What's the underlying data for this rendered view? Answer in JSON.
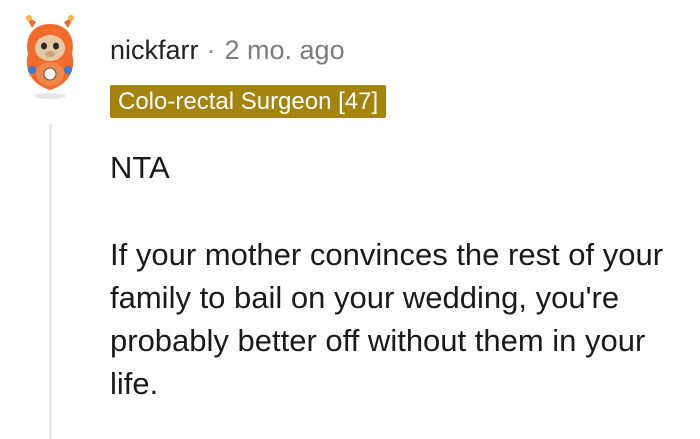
{
  "comment": {
    "author": "nickfarr",
    "separator": "·",
    "timestamp": "2 mo. ago",
    "flair": "Colo-rectal Surgeon [47]",
    "flair_color": "#a4830e",
    "avatar_icon": "snoo-avatar-icon",
    "paragraphs": [
      "NTA",
      "If your mother convinces the rest of your family to bail on your wedding, you're probably better off without them in your life."
    ]
  }
}
